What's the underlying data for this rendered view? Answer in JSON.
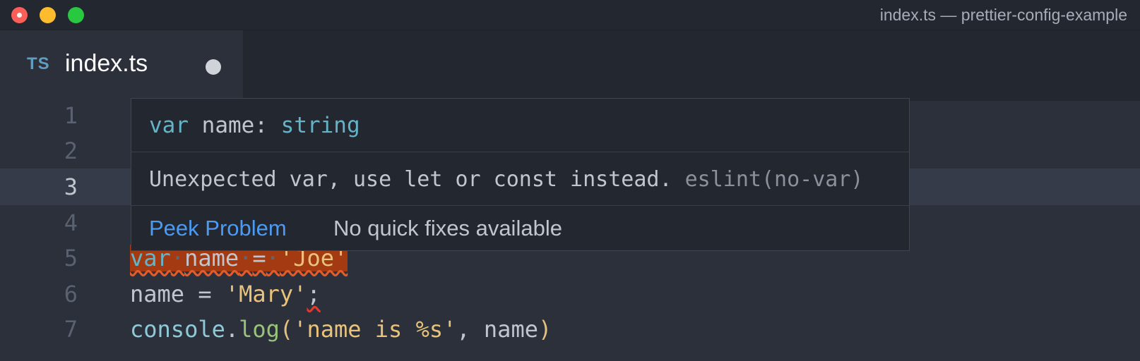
{
  "window": {
    "title": "index.ts — prettier-config-example",
    "traffic_lights": [
      "close",
      "minimize",
      "maximize"
    ]
  },
  "tab": {
    "lang_badge": "TS",
    "filename": "index.ts",
    "dirty_indicator": "unsaved-dot"
  },
  "editor": {
    "lines": [
      {
        "number": "1"
      },
      {
        "number": "2"
      },
      {
        "number": "3"
      },
      {
        "number": "4"
      },
      {
        "number": "5",
        "tokens": {
          "kw": "var",
          "sp1": "·",
          "ident": "name",
          "sp2": "·",
          "op": "=",
          "sp3": "·",
          "str": "'Joe'"
        }
      },
      {
        "number": "6",
        "tokens": {
          "ident": "name",
          "op": " = ",
          "str": "'Mary'",
          "semi": ";"
        }
      },
      {
        "number": "7",
        "tokens": {
          "obj": "console",
          "dot": ".",
          "method": "log",
          "lparen": "(",
          "str": "'name is %s'",
          "comma": ",",
          "ident": "name",
          "rparen": ")"
        }
      }
    ]
  },
  "hover": {
    "signature": {
      "kw": "var",
      "name": " name: ",
      "type": "string"
    },
    "message": "Unexpected var, use let or const instead.",
    "source": "eslint(no-var)",
    "actions": {
      "peek": "Peek Problem",
      "no_fix": "No quick fixes available"
    }
  },
  "colors": {
    "background": "#2b303b",
    "error_highlight": "#a33a12",
    "link": "#4c9af2",
    "keyword": "#64b4c9",
    "string": "#e9c27b"
  }
}
